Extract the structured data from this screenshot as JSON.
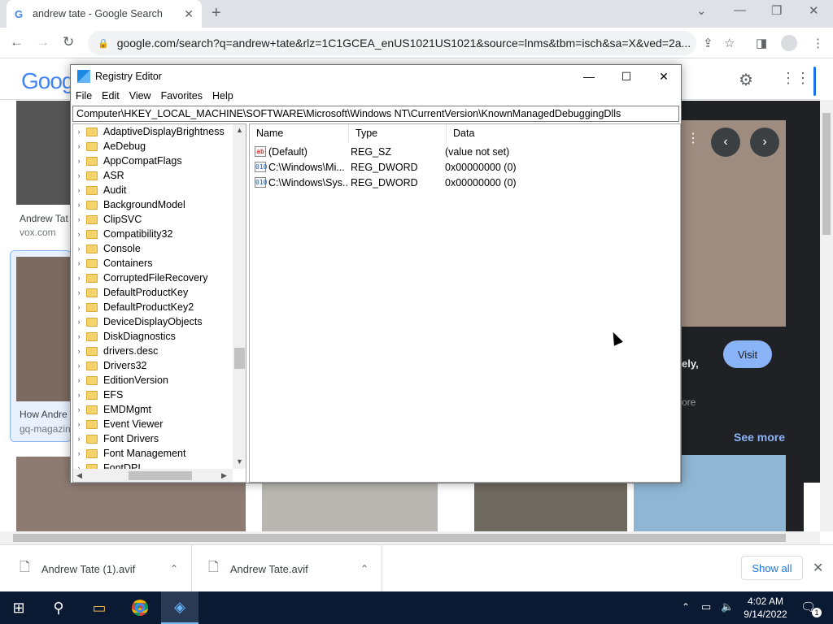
{
  "browser": {
    "tab_title": "andrew tate - Google Search",
    "favicon": "G",
    "url": "google.com/search?q=andrew+tate&rlz=1C1GCEA_enUS1021US1021&source=lnms&tbm=isch&sa=X&ved=2a..."
  },
  "google": {
    "logo": "Goog",
    "results": [
      {
        "caption": "Andrew Tat",
        "source": "vox.com"
      },
      {
        "caption": "How Andre",
        "source": "gq-magazin"
      }
    ],
    "visit_label": "Visit",
    "see_more_label": "See more",
    "side_text_1": "ely,",
    "side_text_2": "ore"
  },
  "downloads": {
    "items": [
      "Andrew Tate (1).avif",
      "Andrew Tate.avif"
    ],
    "show_all": "Show all"
  },
  "taskbar": {
    "time": "4:02 AM",
    "date": "9/14/2022",
    "notification_count": "1"
  },
  "regedit": {
    "title": "Registry Editor",
    "menu": [
      "File",
      "Edit",
      "View",
      "Favorites",
      "Help"
    ],
    "address": "Computer\\HKEY_LOCAL_MACHINE\\SOFTWARE\\Microsoft\\Windows NT\\CurrentVersion\\KnownManagedDebuggingDlls",
    "tree_items": [
      "AdaptiveDisplayBrightness",
      "AeDebug",
      "AppCompatFlags",
      "ASR",
      "Audit",
      "BackgroundModel",
      "ClipSVC",
      "Compatibility32",
      "Console",
      "Containers",
      "CorruptedFileRecovery",
      "DefaultProductKey",
      "DefaultProductKey2",
      "DeviceDisplayObjects",
      "DiskDiagnostics",
      "drivers.desc",
      "Drivers32",
      "EditionVersion",
      "EFS",
      "EMDMgmt",
      "Event Viewer",
      "Font Drivers",
      "Font Management",
      "FontDPI"
    ],
    "columns": [
      "Name",
      "Type",
      "Data"
    ],
    "values": [
      {
        "name": "(Default)",
        "type": "REG_SZ",
        "data": "(value not set)",
        "icon": "ab"
      },
      {
        "name": "C:\\Windows\\Mi...",
        "type": "REG_DWORD",
        "data": "0x00000000 (0)",
        "icon": "010"
      },
      {
        "name": "C:\\Windows\\Sys...",
        "type": "REG_DWORD",
        "data": "0x00000000 (0)",
        "icon": "010"
      }
    ]
  }
}
